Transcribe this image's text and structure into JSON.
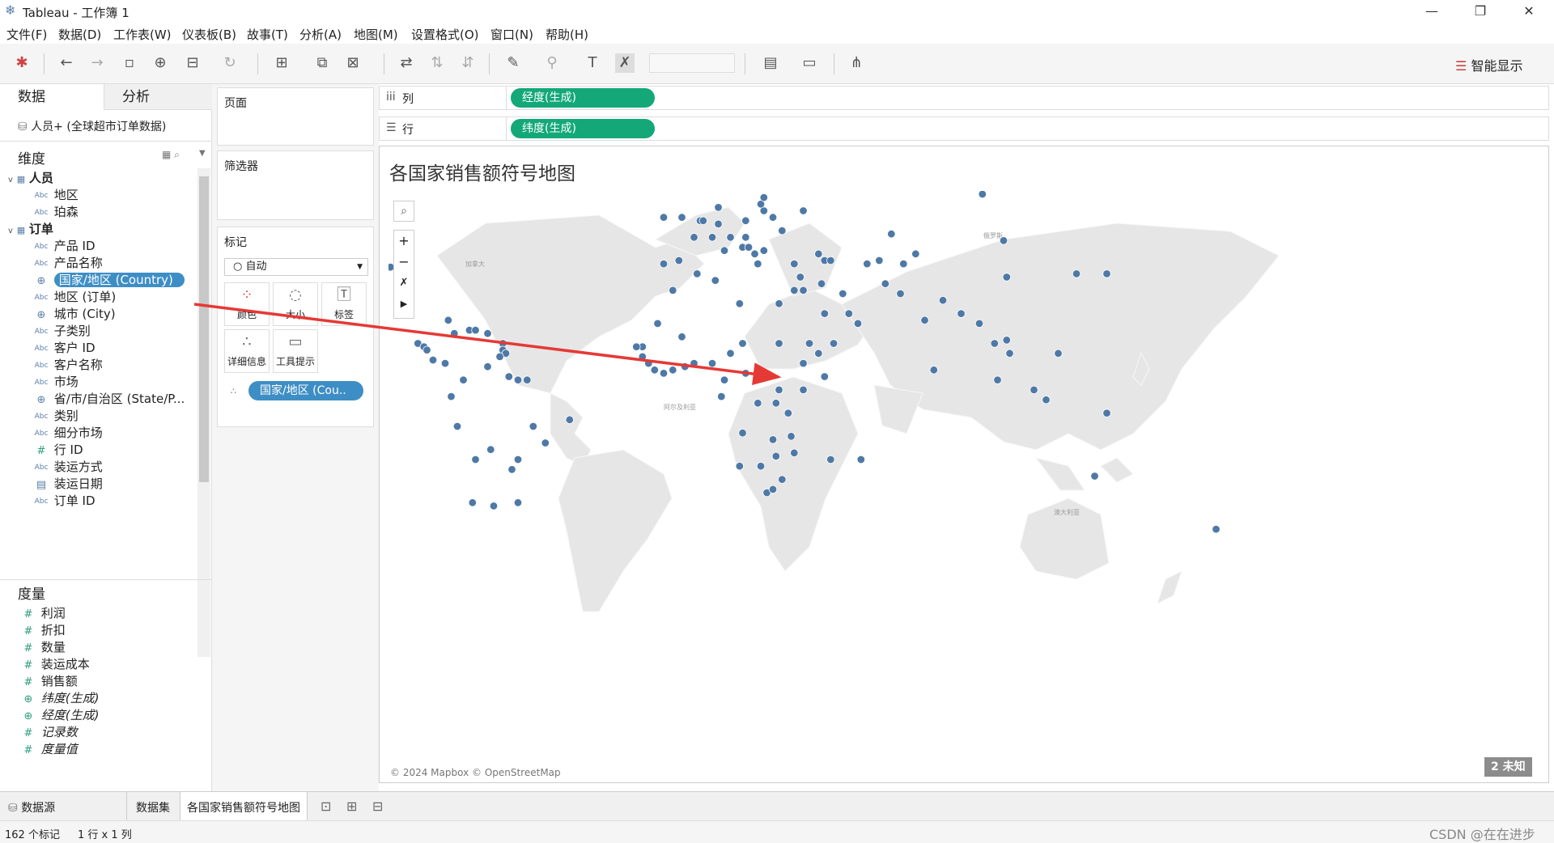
{
  "window": {
    "title": "Tableau - 工作簿 1",
    "minimize": "—",
    "restore": "❐",
    "close": "✕"
  },
  "menu": [
    "文件(F)",
    "数据(D)",
    "工作表(W)",
    "仪表板(B)",
    "故事(T)",
    "分析(A)",
    "地图(M)",
    "设置格式(O)",
    "窗口(N)",
    "帮助(H)"
  ],
  "toolbar": {
    "smart_show": "智能显示"
  },
  "left": {
    "tab_data": "数据",
    "tab_analysis": "分析",
    "datasource": "人员+ (全球超市订单数据)",
    "dimensions_title": "维度",
    "groups": [
      {
        "name": "人员",
        "fields": [
          {
            "type": "Abc",
            "label": "地区"
          },
          {
            "type": "Abc",
            "label": "珀森"
          }
        ]
      },
      {
        "name": "订单",
        "fields": [
          {
            "type": "Abc",
            "label": "产品 ID"
          },
          {
            "type": "Abc",
            "label": "产品名称"
          },
          {
            "type": "geo",
            "label": "国家/地区 (Country)",
            "selected": true
          },
          {
            "type": "Abc",
            "label": "地区 (订单)"
          },
          {
            "type": "geo",
            "label": "城市 (City)"
          },
          {
            "type": "Abc",
            "label": "子类别"
          },
          {
            "type": "Abc",
            "label": "客户 ID"
          },
          {
            "type": "Abc",
            "label": "客户名称"
          },
          {
            "type": "Abc",
            "label": "市场"
          },
          {
            "type": "geo",
            "label": "省/市/自治区 (State/P..."
          },
          {
            "type": "Abc",
            "label": "类别"
          },
          {
            "type": "Abc",
            "label": "细分市场"
          },
          {
            "type": "#",
            "label": "行 ID"
          },
          {
            "type": "Abc",
            "label": "装运方式"
          },
          {
            "type": "date",
            "label": "装运日期"
          },
          {
            "type": "Abc",
            "label": "订单 ID"
          }
        ]
      }
    ],
    "measures_title": "度量",
    "measures": [
      {
        "type": "#",
        "label": "利润",
        "italic": false
      },
      {
        "type": "#",
        "label": "折扣",
        "italic": false
      },
      {
        "type": "#",
        "label": "数量",
        "italic": false
      },
      {
        "type": "#",
        "label": "装运成本",
        "italic": false
      },
      {
        "type": "#",
        "label": "销售额",
        "italic": false
      },
      {
        "type": "geo",
        "label": "纬度(生成)",
        "italic": true
      },
      {
        "type": "geo",
        "label": "经度(生成)",
        "italic": true
      },
      {
        "type": "#",
        "label": "记录数",
        "italic": true
      },
      {
        "type": "#",
        "label": "度量值",
        "italic": true
      }
    ]
  },
  "cards": {
    "pages": "页面",
    "filters": "筛选器",
    "marks": "标记",
    "mark_type": "自动",
    "mark_buttons": [
      "颜色",
      "大小",
      "标签",
      "详细信息",
      "工具提示"
    ],
    "detail_pill": "国家/地区 (Cou.."
  },
  "shelves": {
    "columns_label": "列",
    "columns_pill": "经度(生成)",
    "rows_label": "行",
    "rows_pill": "纬度(生成)"
  },
  "viz": {
    "title": "各国家销售额符号地图",
    "attribution": "© 2024 Mapbox © OpenStreetMap",
    "unknown_badge": "2 未知",
    "map_labels": [
      "加拿大",
      "阿尔及利亚",
      "澳大利亚",
      "俄罗斯"
    ]
  },
  "sheet_tabs": {
    "datasource": "数据源",
    "tabs": [
      "数据集",
      "各国家销售额符号地图"
    ]
  },
  "status": {
    "marks": "162 个标记",
    "rowscols": "1 行 x 1 列",
    "watermark": "CSDN @在在进步"
  },
  "colors": {
    "pill": "#14a879",
    "point": "#4e79a7",
    "selected": "#3e8ec6",
    "arrow": "#e53935"
  },
  "map_points": [
    [
      -98,
      38
    ],
    [
      -102,
      23
    ],
    [
      -89,
      15
    ],
    [
      -87,
      14
    ],
    [
      -86,
      13
    ],
    [
      -84,
      10
    ],
    [
      -80,
      9
    ],
    [
      -79,
      22
    ],
    [
      -77,
      18
    ],
    [
      -72,
      19
    ],
    [
      -70,
      19
    ],
    [
      -66,
      18
    ],
    [
      -61,
      15
    ],
    [
      -61,
      13
    ],
    [
      -60,
      12
    ],
    [
      -62,
      11
    ],
    [
      -74,
      4
    ],
    [
      -66,
      8
    ],
    [
      -59,
      5
    ],
    [
      -56,
      4
    ],
    [
      -53,
      4
    ],
    [
      -78,
      -1
    ],
    [
      -76,
      -10
    ],
    [
      -65,
      -17
    ],
    [
      -58,
      -23
    ],
    [
      -56,
      -33
    ],
    [
      -64,
      -34
    ],
    [
      -71,
      -33
    ],
    [
      -51,
      -10
    ],
    [
      -39,
      -8
    ],
    [
      -47,
      -15
    ],
    [
      -56,
      -20
    ],
    [
      -70,
      -20
    ],
    [
      -3,
      40
    ],
    [
      -8,
      39
    ],
    [
      2,
      47
    ],
    [
      -2,
      53
    ],
    [
      -8,
      53
    ],
    [
      4,
      52
    ],
    [
      5,
      52
    ],
    [
      10,
      51
    ],
    [
      14,
      47
    ],
    [
      8,
      47
    ],
    [
      12,
      43
    ],
    [
      18,
      44
    ],
    [
      20,
      44
    ],
    [
      22,
      42
    ],
    [
      23,
      39
    ],
    [
      25,
      43
    ],
    [
      19,
      47
    ],
    [
      19,
      52
    ],
    [
      25,
      55
    ],
    [
      24,
      57
    ],
    [
      25,
      59
    ],
    [
      10,
      62
    ],
    [
      18,
      62
    ],
    [
      26,
      62
    ],
    [
      15,
      68
    ],
    [
      10,
      56
    ],
    [
      31,
      49
    ],
    [
      38,
      55
    ],
    [
      28,
      53
    ],
    [
      35,
      39
    ],
    [
      37,
      35
    ],
    [
      35,
      31
    ],
    [
      38,
      31
    ],
    [
      44,
      33
    ],
    [
      45,
      24
    ],
    [
      53,
      24
    ],
    [
      56,
      21
    ],
    [
      48,
      15
    ],
    [
      51,
      30
    ],
    [
      65,
      33
    ],
    [
      70,
      30
    ],
    [
      78,
      22
    ],
    [
      84,
      28
    ],
    [
      90,
      24
    ],
    [
      81,
      7
    ],
    [
      96,
      21
    ],
    [
      101,
      15
    ],
    [
      105,
      16
    ],
    [
      106,
      12
    ],
    [
      102,
      4
    ],
    [
      114,
      1
    ],
    [
      118,
      -2
    ],
    [
      122,
      12
    ],
    [
      138,
      -6
    ],
    [
      134,
      -25
    ],
    [
      174,
      -41
    ],
    [
      105,
      35
    ],
    [
      104,
      46
    ],
    [
      138,
      36
    ],
    [
      128,
      36
    ],
    [
      97,
      60
    ],
    [
      67,
      48
    ],
    [
      75,
      42
    ],
    [
      71,
      39
    ],
    [
      63,
      40
    ],
    [
      59,
      39
    ],
    [
      45,
      40
    ],
    [
      43,
      42
    ],
    [
      47,
      40
    ],
    [
      3,
      36
    ],
    [
      9,
      34
    ],
    [
      17,
      27
    ],
    [
      30,
      27
    ],
    [
      30,
      15
    ],
    [
      18,
      15
    ],
    [
      -2,
      17
    ],
    [
      -10,
      21
    ],
    [
      -15,
      14
    ],
    [
      -15,
      11
    ],
    [
      -13,
      9
    ],
    [
      -11,
      7
    ],
    [
      -8,
      6
    ],
    [
      -5,
      7
    ],
    [
      -1,
      8
    ],
    [
      2,
      9
    ],
    [
      8,
      9
    ],
    [
      12,
      4
    ],
    [
      14,
      12
    ],
    [
      19,
      6
    ],
    [
      24,
      7
    ],
    [
      38,
      9
    ],
    [
      45,
      5
    ],
    [
      38,
      1
    ],
    [
      30,
      1
    ],
    [
      33,
      -6
    ],
    [
      29,
      -3
    ],
    [
      23,
      -3
    ],
    [
      11,
      -1
    ],
    [
      18,
      -12
    ],
    [
      28,
      -14
    ],
    [
      34,
      -13
    ],
    [
      35,
      -18
    ],
    [
      29,
      -19
    ],
    [
      24,
      -22
    ],
    [
      17,
      -22
    ],
    [
      26,
      -30
    ],
    [
      31,
      -26
    ],
    [
      28,
      -29
    ],
    [
      47,
      -20
    ],
    [
      57,
      -20
    ],
    [
      43,
      12
    ],
    [
      40,
      15
    ],
    [
      -17,
      14
    ],
    [
      -5,
      31
    ]
  ]
}
